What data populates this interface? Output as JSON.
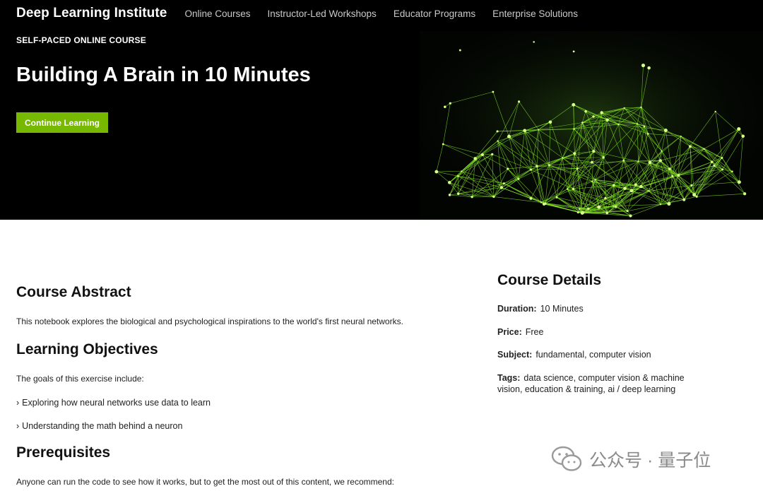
{
  "nav": {
    "brand": "Deep Learning Institute",
    "links": [
      {
        "label": "Online Courses"
      },
      {
        "label": "Instructor-Led Workshops"
      },
      {
        "label": "Educator Programs"
      },
      {
        "label": "Enterprise Solutions"
      }
    ]
  },
  "hero": {
    "eyebrow": "SELF-PACED ONLINE COURSE",
    "title": "Building A Brain in 10 Minutes",
    "cta_label": "Continue Learning",
    "accent_color": "#76b900",
    "art_color": "#8ef02a"
  },
  "abstract": {
    "heading": "Course Abstract",
    "text": "This notebook explores the biological and psychological inspirations to the world's first neural networks."
  },
  "objectives": {
    "heading": "Learning Objectives",
    "intro": "The goals of this exercise include:",
    "bullet_glyph": "›",
    "items": [
      "Exploring how neural networks use data to learn",
      "Understanding the math behind a neuron"
    ]
  },
  "prerequisites": {
    "heading": "Prerequisites",
    "text": "Anyone can run the code to see how it works, but to get the most out of this content, we recommend:"
  },
  "details": {
    "heading": "Course Details",
    "duration_label": "Duration:",
    "duration": "10 Minutes",
    "price_label": "Price:",
    "price": "Free",
    "subject_label": "Subject:",
    "subject": "fundamental, computer vision",
    "tags_label": "Tags:",
    "tags": "data science, computer vision & machine vision, education & training, ai / deep learning"
  },
  "watermark": {
    "text": "公众号 · 量子位",
    "icon": "wechat-icon"
  }
}
